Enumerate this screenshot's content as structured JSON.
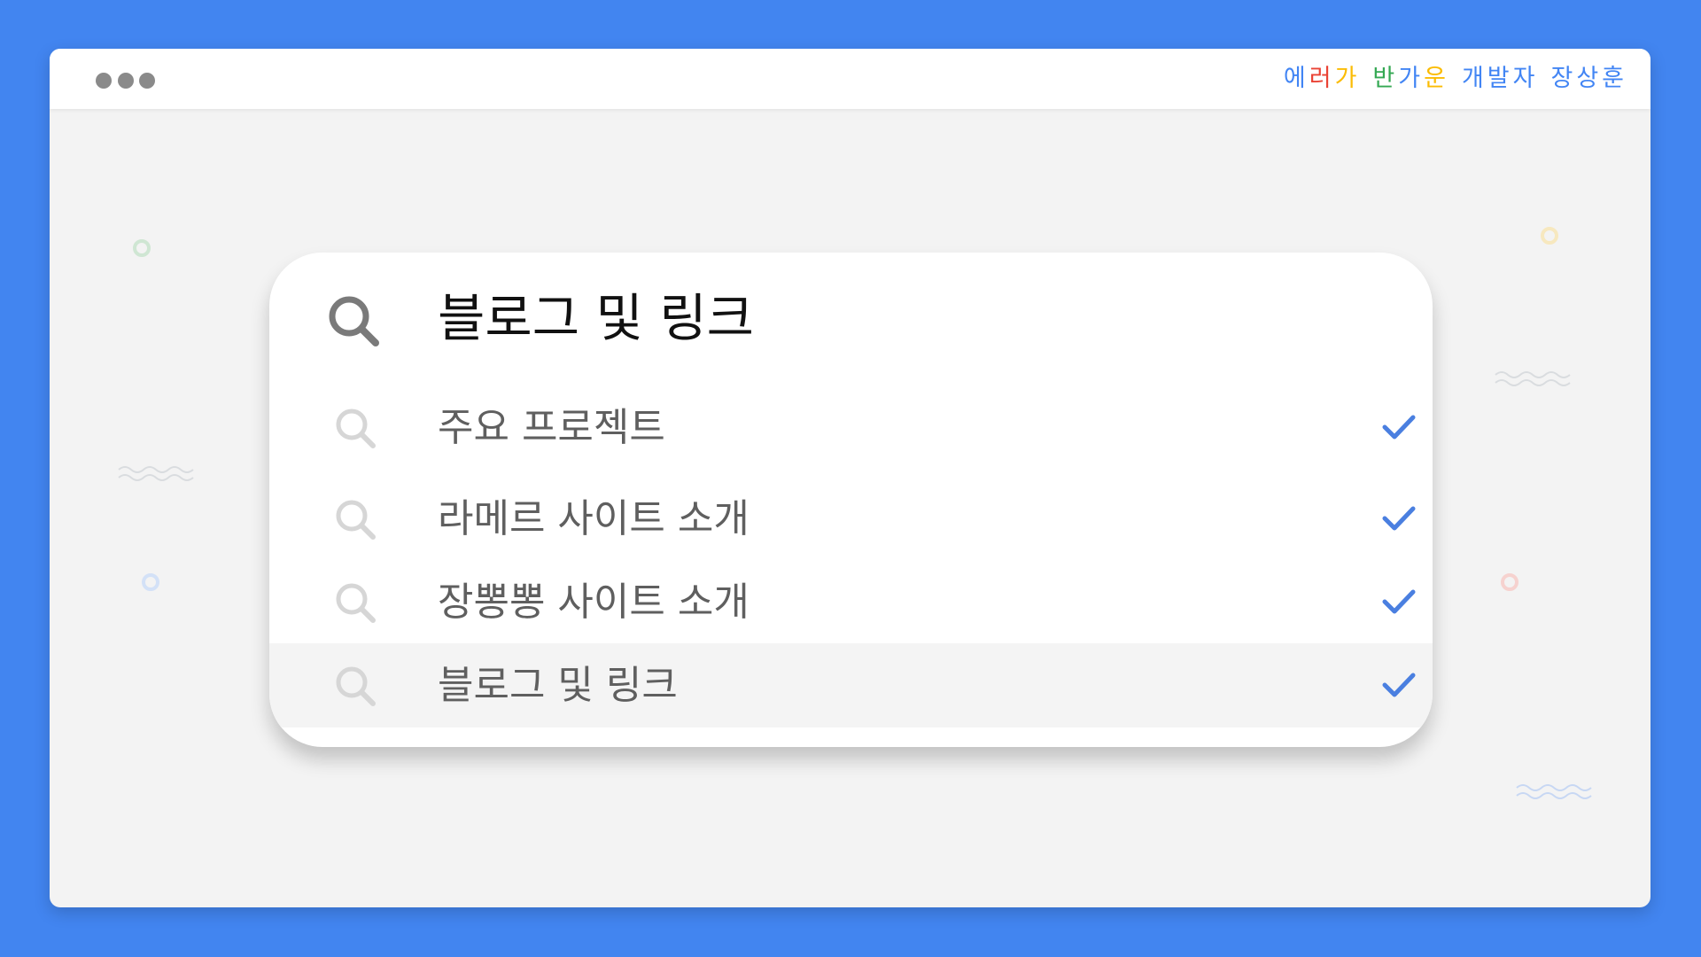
{
  "window": {
    "controls": [
      "dot",
      "dot",
      "dot"
    ],
    "greeting": {
      "line1": [
        {
          "char": "에",
          "color": "#4285f4"
        },
        {
          "char": "러",
          "color": "#ea4335"
        },
        {
          "char": "가",
          "color": "#fbbc05"
        }
      ],
      "line2": [
        {
          "char": "반",
          "color": "#34a853"
        },
        {
          "char": "가",
          "color": "#4285f4"
        },
        {
          "char": "운",
          "color": "#fbbc05"
        }
      ],
      "line3": [
        {
          "char": "개",
          "color": "#4285f4"
        },
        {
          "char": "발",
          "color": "#4285f4"
        },
        {
          "char": "자",
          "color": "#4285f4"
        }
      ],
      "line4": [
        {
          "char": "장",
          "color": "#4285f4"
        },
        {
          "char": "상",
          "color": "#4285f4"
        },
        {
          "char": "훈",
          "color": "#4285f4"
        }
      ]
    }
  },
  "search": {
    "query": "블로그 및 링크",
    "icon": "search-icon"
  },
  "suggestions": [
    {
      "label": "주요 프로젝트",
      "icon": "search-icon",
      "selected": true
    },
    {
      "label": "라메르 사이트 소개",
      "icon": "search-icon",
      "selected": true
    },
    {
      "label": "장뽕뽕 사이트 소개",
      "icon": "search-icon",
      "selected": true
    },
    {
      "label": "블로그 및 링크",
      "icon": "search-icon",
      "selected": true,
      "highlighted": true
    }
  ],
  "colors": {
    "background": "#4285f0",
    "check": "#4a7fe0",
    "icon_dark": "#7a7a7a",
    "icon_light": "#d6d6d6"
  }
}
